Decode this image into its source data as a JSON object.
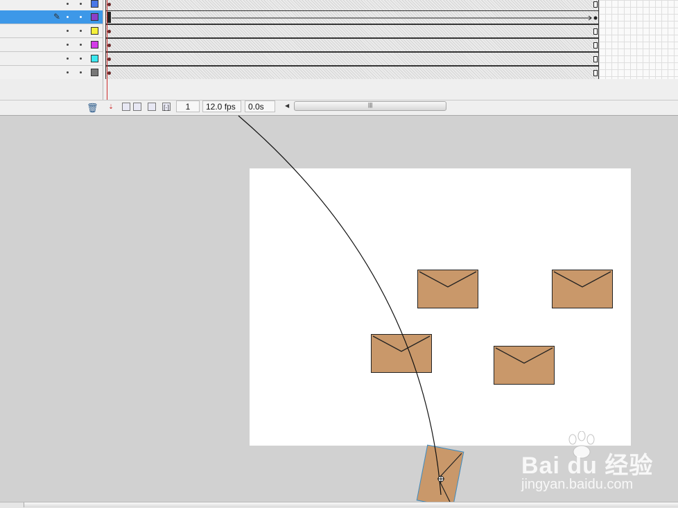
{
  "timeline": {
    "layers": [
      {
        "color": "#4a78e8",
        "selected": false
      },
      {
        "color": "#8b3fc9",
        "selected": true
      },
      {
        "color": "#f5f03c",
        "selected": false
      },
      {
        "color": "#d43ce8",
        "selected": false
      },
      {
        "color": "#3ce8f0",
        "selected": false
      },
      {
        "color": "#777777",
        "selected": false
      }
    ],
    "current_frame": "1",
    "frame_rate": "12.0 fps",
    "elapsed_time": "0.0s",
    "icons": [
      "delete-layer-icon",
      "center-frame-icon",
      "onion-skin-icon",
      "onion-skin-outlines-icon",
      "edit-multiple-frames-icon",
      "modify-onion-markers-icon"
    ]
  },
  "stage": {
    "background": "#ffffff",
    "envelope_color": "#c9986a",
    "envelope_count": 4
  },
  "watermark": {
    "brand": "Bai du 经验",
    "url": "jingyan.baidu.com"
  }
}
